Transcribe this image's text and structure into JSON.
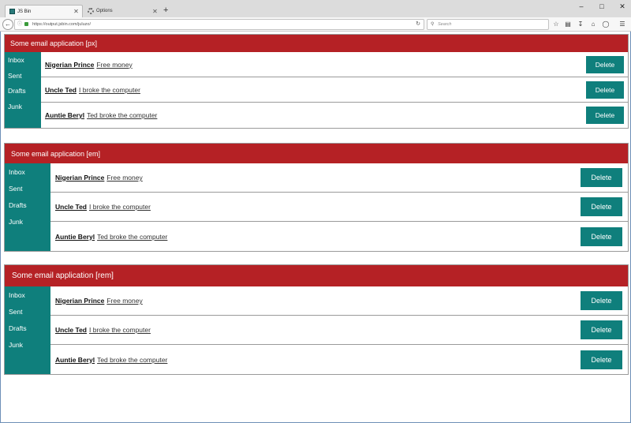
{
  "browser": {
    "tabs": [
      {
        "title": "JS Bin",
        "active": true
      },
      {
        "title": "Options",
        "active": false
      }
    ],
    "new_tab_label": "+",
    "url": "https://output.jsbin.com/juluzo/",
    "search_placeholder": "Search",
    "icons": [
      "back-icon",
      "info-icon",
      "lock-icon",
      "reload-icon",
      "search-icon",
      "bookmark-star-icon",
      "reading-list-icon",
      "download-icon",
      "home-icon",
      "pocket-icon",
      "menu-icon"
    ]
  },
  "apps": [
    {
      "title": "Some email application [px]",
      "nav": [
        "Inbox",
        "Sent",
        "Drafts",
        "Junk"
      ],
      "messages": [
        {
          "sender": "Nigerian Prince",
          "subject": "Free money",
          "action": "Delete"
        },
        {
          "sender": "Uncle Ted",
          "subject": "I broke the computer",
          "action": "Delete"
        },
        {
          "sender": "Auntie Beryl",
          "subject": "Ted broke the computer",
          "action": "Delete"
        }
      ]
    },
    {
      "title": "Some email application [em]",
      "nav": [
        "Inbox",
        "Sent",
        "Drafts",
        "Junk"
      ],
      "messages": [
        {
          "sender": "Nigerian Prince",
          "subject": "Free money",
          "action": "Delete"
        },
        {
          "sender": "Uncle Ted",
          "subject": "I broke the computer",
          "action": "Delete"
        },
        {
          "sender": "Auntie Beryl",
          "subject": "Ted broke the computer",
          "action": "Delete"
        }
      ]
    },
    {
      "title": "Some email application [rem]",
      "nav": [
        "Inbox",
        "Sent",
        "Drafts",
        "Junk"
      ],
      "messages": [
        {
          "sender": "Nigerian Prince",
          "subject": "Free money",
          "action": "Delete"
        },
        {
          "sender": "Uncle Ted",
          "subject": "I broke the computer",
          "action": "Delete"
        },
        {
          "sender": "Auntie Beryl",
          "subject": "Ted broke the computer",
          "action": "Delete"
        }
      ]
    }
  ],
  "colors": {
    "header_red": "#b52125",
    "teal": "#0f7f7c",
    "text_white": "#ffffff"
  }
}
